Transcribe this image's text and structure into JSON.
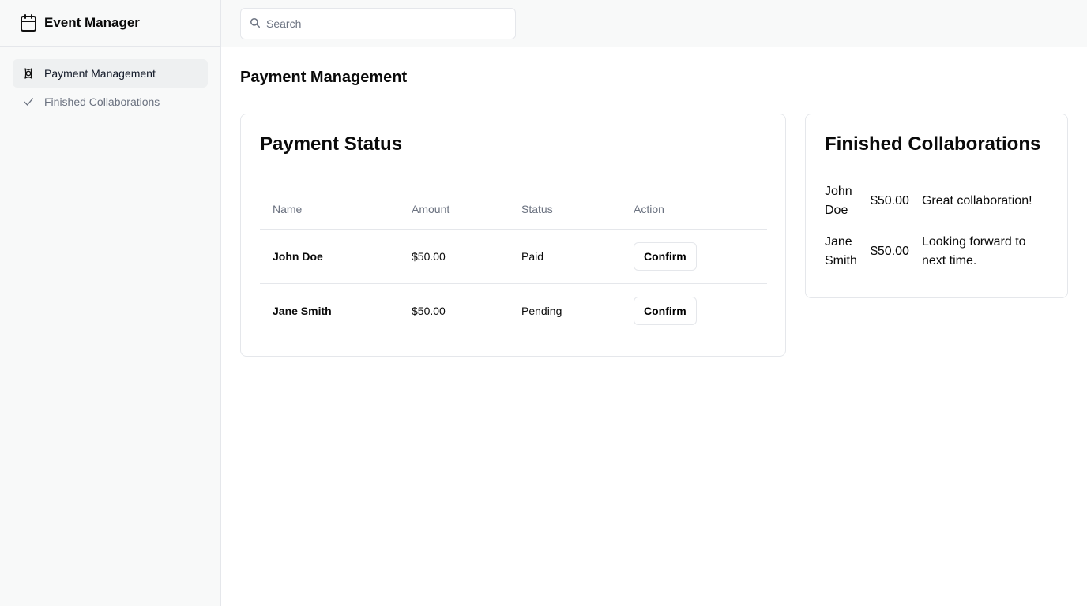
{
  "app": {
    "title": "Event Manager"
  },
  "sidebar": {
    "items": [
      {
        "label": "Payment Management",
        "icon": "badge-icon",
        "active": true
      },
      {
        "label": "Finished Collaborations",
        "icon": "check-icon",
        "active": false
      }
    ]
  },
  "search": {
    "placeholder": "Search",
    "value": ""
  },
  "main": {
    "title": "Payment Management"
  },
  "payment_status": {
    "title": "Payment Status",
    "columns": [
      "Name",
      "Amount",
      "Status",
      "Action"
    ],
    "rows": [
      {
        "name": "John Doe",
        "amount": "$50.00",
        "status": "Paid",
        "action": "Confirm"
      },
      {
        "name": "Jane Smith",
        "amount": "$50.00",
        "status": "Pending",
        "action": "Confirm"
      }
    ]
  },
  "finished_collaborations": {
    "title": "Finished Collaborations",
    "items": [
      {
        "name": "John Doe",
        "amount": "$50.00",
        "message": "Great collaboration!"
      },
      {
        "name": "Jane Smith",
        "amount": "$50.00",
        "message": "Looking forward to next time."
      }
    ]
  },
  "colors": {
    "sidebar_bg": "#f8f9f9",
    "border": "#e5e7eb",
    "muted_text": "#6b7280",
    "active_item_bg": "#eef0f1"
  }
}
